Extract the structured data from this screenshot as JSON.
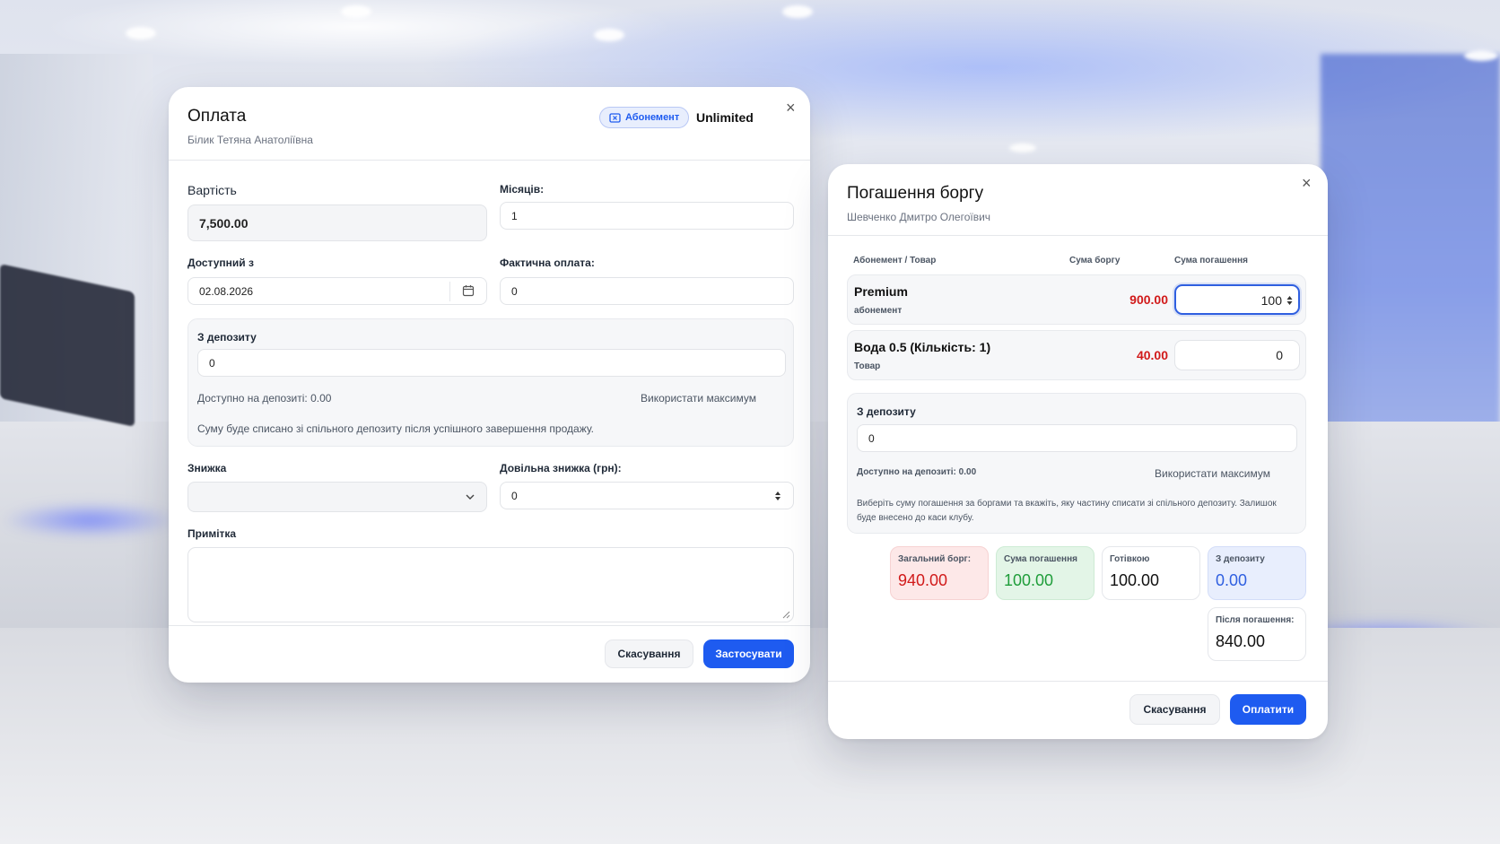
{
  "payment": {
    "title": "Оплата",
    "client": "Білик Тетяна Анатоліївна",
    "badge_label": "Абонемент",
    "plan_name": "Unlimited",
    "close_symbol": "×",
    "cost_label": "Вартість",
    "cost_value": "7,500.00",
    "months_label": "Місяців:",
    "months_value": "1",
    "available_from_label": "Доступний з",
    "available_from_value": "02.08.2026",
    "actual_payment_label": "Фактична оплата:",
    "actual_payment_value": "0",
    "deposit_label": "З депозиту",
    "deposit_value": "0",
    "deposit_available": "Доступно на депозиті: 0.00",
    "use_max_label": "Використати максимум",
    "deposit_note": "Суму буде списано зі спільного депозиту після успішного завершення продажу.",
    "discount_label": "Знижка",
    "discount_value": "",
    "custom_discount_label": "Довільна знижка (грн):",
    "custom_discount_value": "0",
    "note_label": "Примітка",
    "note_value": "",
    "cancel_label": "Скасування",
    "apply_label": "Застосувати"
  },
  "debt": {
    "title": "Погашення боргу",
    "client": "Шевченко Дмитро Олегоївич",
    "close_symbol": "×",
    "columns": [
      "Абонемент / Товар",
      "Сума боргу",
      "Сума погашення"
    ],
    "rows": [
      {
        "name": "Premium",
        "type": "абонемент",
        "debt": "900.00",
        "repay": "100"
      },
      {
        "name": "Вода 0.5 (Кількість: 1)",
        "type": "Товар",
        "debt": "40.00",
        "repay": "0"
      }
    ],
    "deposit_label": "З депозиту",
    "deposit_value": "0",
    "deposit_available": "Доступно на депозиті: 0.00",
    "use_max_label": "Використати максимум",
    "note": "Виберіть суму погашення за боргами та вкажіть, яку частину списати зі спільного депозиту. Залишок буде внесено до каси клубу.",
    "summary": {
      "total_label": "Загальний борг:",
      "total_value": "940.00",
      "repay_label": "Сума погашення",
      "repay_value": "100.00",
      "cash_label": "Готівкою",
      "cash_value": "100.00",
      "deposit_label": "З депозиту",
      "deposit_value": "0.00",
      "after_label": "Після погашення:",
      "after_value": "840.00"
    },
    "cancel_label": "Скасування",
    "pay_label": "Оплатити"
  },
  "colors": {
    "primary": "#1e5bf0",
    "debt_red": "#d11a1a",
    "green": "#1f9d3a",
    "deposit_blue": "#2f5fe0"
  },
  "icons": [
    "ticket-icon",
    "calendar-icon",
    "chevron-down-icon",
    "stepper-icon",
    "close-icon",
    "resize-handle-icon"
  ]
}
